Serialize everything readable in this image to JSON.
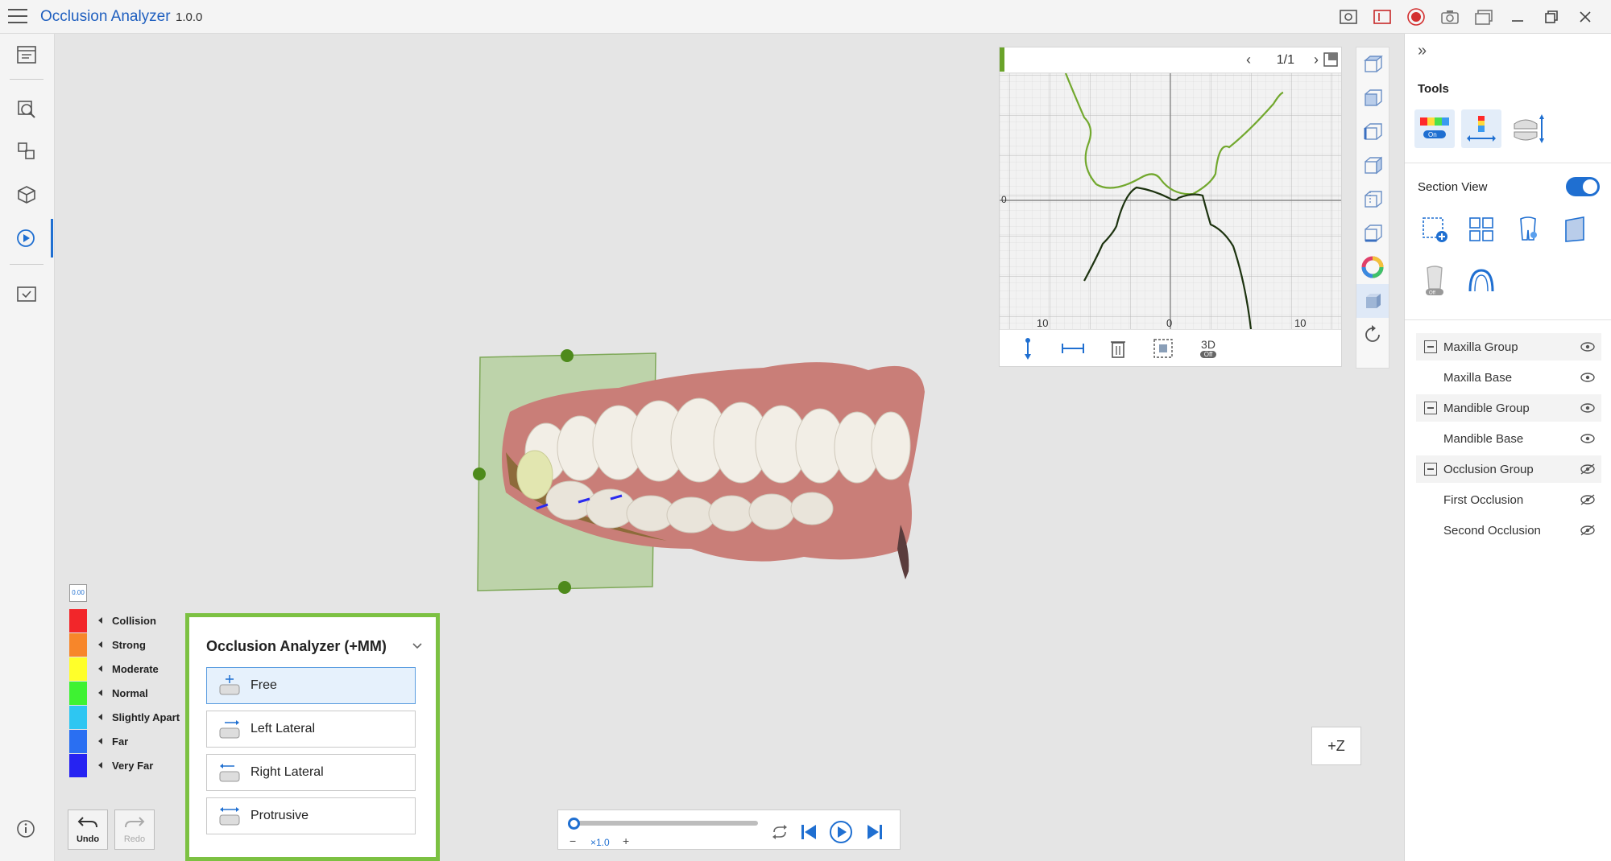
{
  "app": {
    "title": "Occlusion Analyzer",
    "version": "1.0.0"
  },
  "chart_panel": {
    "pager": "1/1",
    "tick_left": "10",
    "tick_center": "0",
    "tick_right": "10",
    "tick_zero": "0",
    "badge_3d": "3D",
    "badge_off": "Off"
  },
  "right_panel": {
    "tools_heading": "Tools",
    "tools_on_label": "On",
    "section_view_label": "Section View",
    "section_off_label": "Off",
    "layers": [
      {
        "label": "Maxilla Group",
        "group": true,
        "visible": true
      },
      {
        "label": "Maxilla Base",
        "group": false,
        "visible": true
      },
      {
        "label": "Mandible Group",
        "group": true,
        "visible": true
      },
      {
        "label": "Mandible Base",
        "group": false,
        "visible": true
      },
      {
        "label": "Occlusion Group",
        "group": true,
        "visible": false
      },
      {
        "label": "First Occlusion",
        "group": false,
        "visible": false
      },
      {
        "label": "Second Occlusion",
        "group": false,
        "visible": false
      }
    ]
  },
  "legend": {
    "zero_label": "0.00",
    "items": [
      {
        "label": "Collision",
        "color": "#f2262a"
      },
      {
        "label": "Strong",
        "color": "#f7862a"
      },
      {
        "label": "Moderate",
        "color": "#ffff2a"
      },
      {
        "label": "Normal",
        "color": "#3ef232"
      },
      {
        "label": "Slightly Apart",
        "color": "#2ec6f2"
      },
      {
        "label": "Far",
        "color": "#2a6ff2"
      },
      {
        "label": "Very Far",
        "color": "#2623f2"
      }
    ]
  },
  "history": {
    "undo": "Undo",
    "redo": "Redo"
  },
  "analyzer_panel": {
    "title": "Occlusion Analyzer (+MM)",
    "modes": [
      "Free",
      "Left Lateral",
      "Right Lateral",
      "Protrusive"
    ],
    "selected": "Free"
  },
  "playback": {
    "speed": "×1.0",
    "minus": "−",
    "plus": "+"
  },
  "orientation": {
    "label": "+Z"
  },
  "colors": {
    "accent": "#1f6fd1",
    "highlight_border": "#7cc142"
  }
}
